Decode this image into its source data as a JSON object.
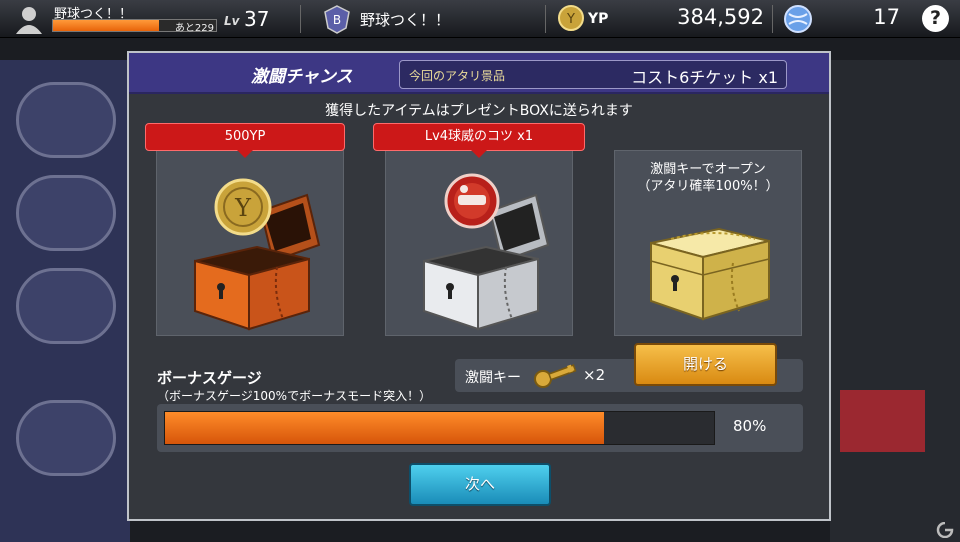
{
  "topbar": {
    "player_name": "野球つく！！",
    "exp_text": "あと229",
    "exp_progress": 0.65,
    "level_label": "Lv",
    "level": "37",
    "club_name": "野球つく！！",
    "currency_label": "YP",
    "currency_amount": "384,592",
    "ball_count": "17",
    "help_label": "?"
  },
  "modal": {
    "title": "激闘チャンス",
    "prize_label": "今回のアタリ景品",
    "prize_value": "コスト6チケット x1",
    "notice": "獲得したアイテムはプレゼントBOXに送られます",
    "cards": [
      {
        "tag": "500YP",
        "chest_color": "orange",
        "item_icon": "yp-coin-icon"
      },
      {
        "tag": "Lv4球威のコツ x1",
        "chest_color": "silver",
        "item_icon": "skill-tip-icon"
      },
      {
        "line1": "激闘キーでオープン",
        "line2": "（アタリ確率100%！）",
        "chest_color": "gold"
      }
    ],
    "key_label": "激闘キー",
    "key_count": "×2",
    "open_button": "開ける",
    "bonus_title": "ボーナスゲージ",
    "bonus_subtitle": "（ボーナスゲージ100%でボーナスモード突入！）",
    "bonus_percent": 80,
    "bonus_percent_text": "80%",
    "next_button": "次へ"
  },
  "colors": {
    "header_purple": "#3d3784",
    "tag_red": "#cc1818",
    "gauge_orange": "#e8640a",
    "open_button_gold": "#f0a830",
    "next_button_blue": "#2aa8d0"
  }
}
